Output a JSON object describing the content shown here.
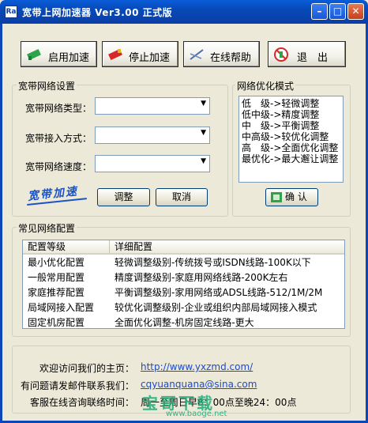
{
  "window": {
    "title": "宽带上网加速器  Ver3.00 正式版",
    "app_icon": "Ra",
    "controls": {
      "minimize": "–",
      "maximize": "□",
      "close": "✕"
    }
  },
  "toolbar": {
    "start_label": "启用加速",
    "stop_label": "停止加速",
    "help_label": "在线帮助",
    "exit_label": "退　出"
  },
  "settings": {
    "legend": "宽带网络设置",
    "type_label": "宽带网络类型：",
    "access_label": "宽带接入方式：",
    "speed_label": "宽带网络速度：",
    "type_value": "",
    "access_value": "",
    "speed_value": "",
    "stamp_text": "宽带加速",
    "adjust_label": "调整",
    "cancel_label": "取消"
  },
  "optimize": {
    "legend": "网络优化模式",
    "modes": [
      "低　级->轻微调整",
      "低中级->精度调整",
      "中　级->平衡调整",
      "中高级->较优化调整",
      "高　级->全面优化调整",
      "最优化->最大邂让调整"
    ],
    "confirm_label": "确 认"
  },
  "common": {
    "legend": "常见网络配置",
    "columns": [
      "配置等级",
      "详细配置"
    ],
    "rows": [
      {
        "level": "最小优化配置",
        "detail": "轻微调整级别-传统拨号或ISDN线路-100K以下"
      },
      {
        "level": "一般常用配置",
        "detail": "精度调整级别-家庭用网络线路-200K左右"
      },
      {
        "level": "家庭推荐配置",
        "detail": "平衡调整级别-家用网络或ADSL线路-512/1M/2M"
      },
      {
        "level": "局域网接入配置",
        "detail": "较优化调整级别-企业或组织内部局域网接入模式"
      },
      {
        "level": "固定机房配置",
        "detail": "全面优化调整-机房固定线路-更大"
      }
    ]
  },
  "footer": {
    "homepage_label": "欢迎访问我们的主页：",
    "homepage_url": "http://www.yxzmd.com/",
    "email_label": "有问题请发邮件联系我们：",
    "email": "cqyuanquana@sina.com",
    "hours_label": "客服在线咨询联络时间：",
    "hours_value": "周一至周日早8：00点至晚24：00点"
  },
  "watermark": {
    "brand": "宝哥下载",
    "url": "www.baoge.net"
  },
  "colors": {
    "titlebar": "#0b47b8",
    "face": "#ece9d8",
    "link": "#1d4bc6",
    "stamp": "#1b53c4"
  }
}
